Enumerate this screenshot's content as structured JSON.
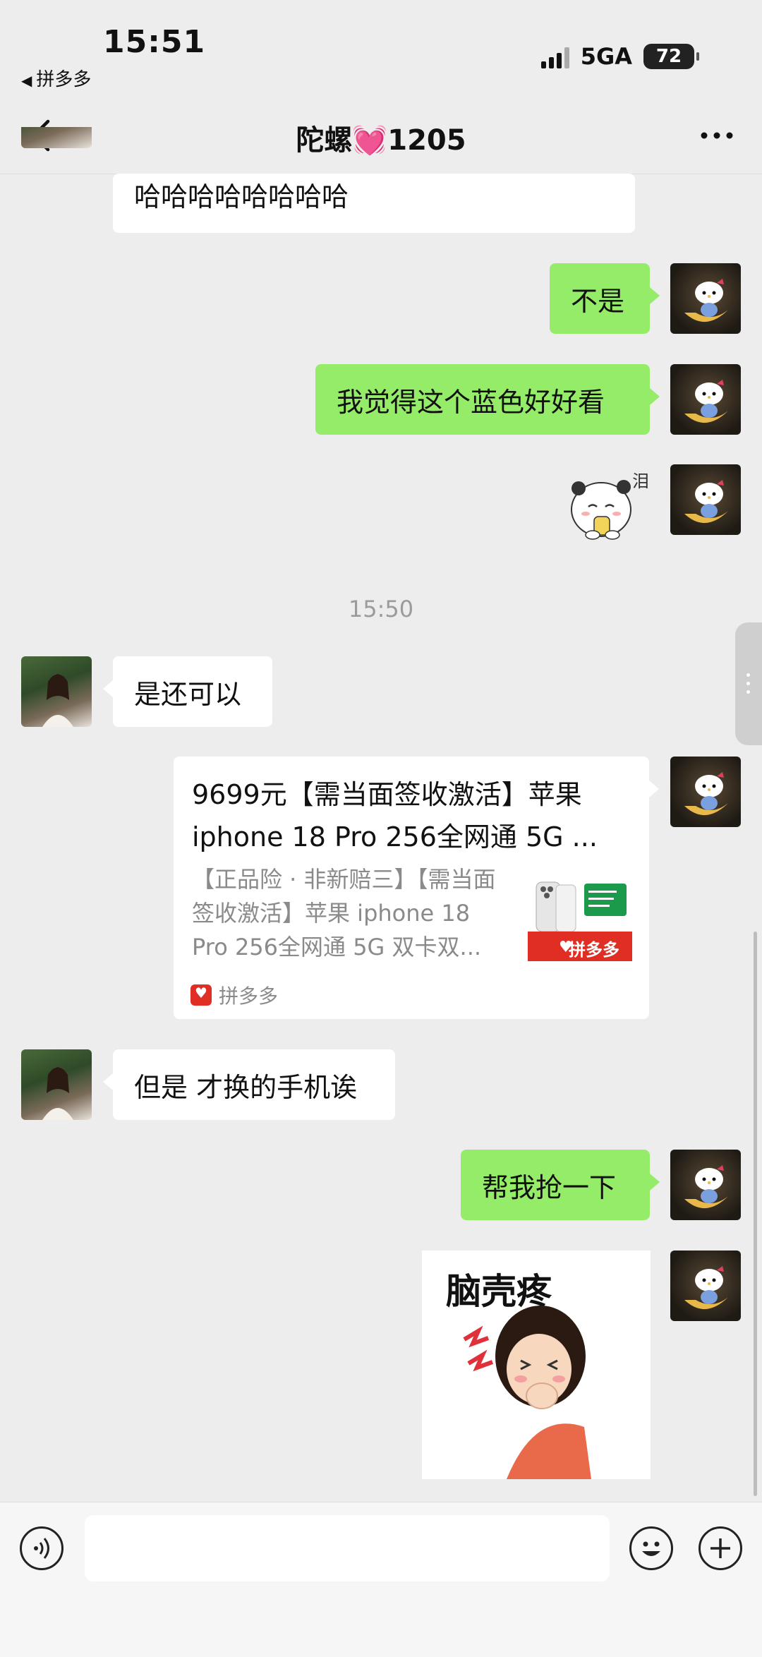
{
  "status_bar": {
    "time": "15:51",
    "back_app": "拼多多",
    "network": "5GA",
    "battery": "72"
  },
  "nav": {
    "title": "陀螺",
    "title_suffix": "1205",
    "title_emoji": "💓"
  },
  "messages": [
    {
      "sender": "contact",
      "type": "text",
      "text": "哈哈哈哈哈哈哈哈"
    },
    {
      "sender": "me",
      "type": "text",
      "text": "不是"
    },
    {
      "sender": "me",
      "type": "text",
      "text": "我觉得这个蓝色好好看"
    },
    {
      "sender": "me",
      "type": "sticker",
      "sticker": "panda-tear-sticker",
      "sticker_text": "泪"
    },
    {
      "sender": "contact",
      "type": "text",
      "text": "是还可以"
    },
    {
      "sender": "me",
      "type": "link_card",
      "title": "9699元【需当面签收激活】苹果iphone 18 Pro 256全网通 5G ...",
      "title_line1": "9699元【需当面签收激活】苹果",
      "title_line2": "iphone 18 Pro 256全网通 5G ...",
      "desc_line1": "【正品险 · 非新赔三】【需当面",
      "desc_line2": "签收激活】苹果 iphone 18",
      "desc_line3": "Pro 256全网通 5G 双卡双...",
      "thumb_badge": "拼多多",
      "source": "拼多多"
    },
    {
      "sender": "contact",
      "type": "text",
      "text": "但是 才换的手机诶"
    },
    {
      "sender": "me",
      "type": "text",
      "text": "帮我抢一下"
    },
    {
      "sender": "me",
      "type": "sticker",
      "sticker": "headache-girl-sticker",
      "sticker_text": "脑壳疼"
    }
  ],
  "timestamp": "15:50",
  "input_bar": {
    "placeholder": "",
    "voice_icon": "voice-icon",
    "emoji_icon": "emoji-icon",
    "plus_icon": "plus-icon"
  },
  "colors": {
    "sent_bubble": "#95ec69",
    "received_bubble": "#ffffff",
    "background": "#ededed",
    "pdd_red": "#e02e24"
  }
}
